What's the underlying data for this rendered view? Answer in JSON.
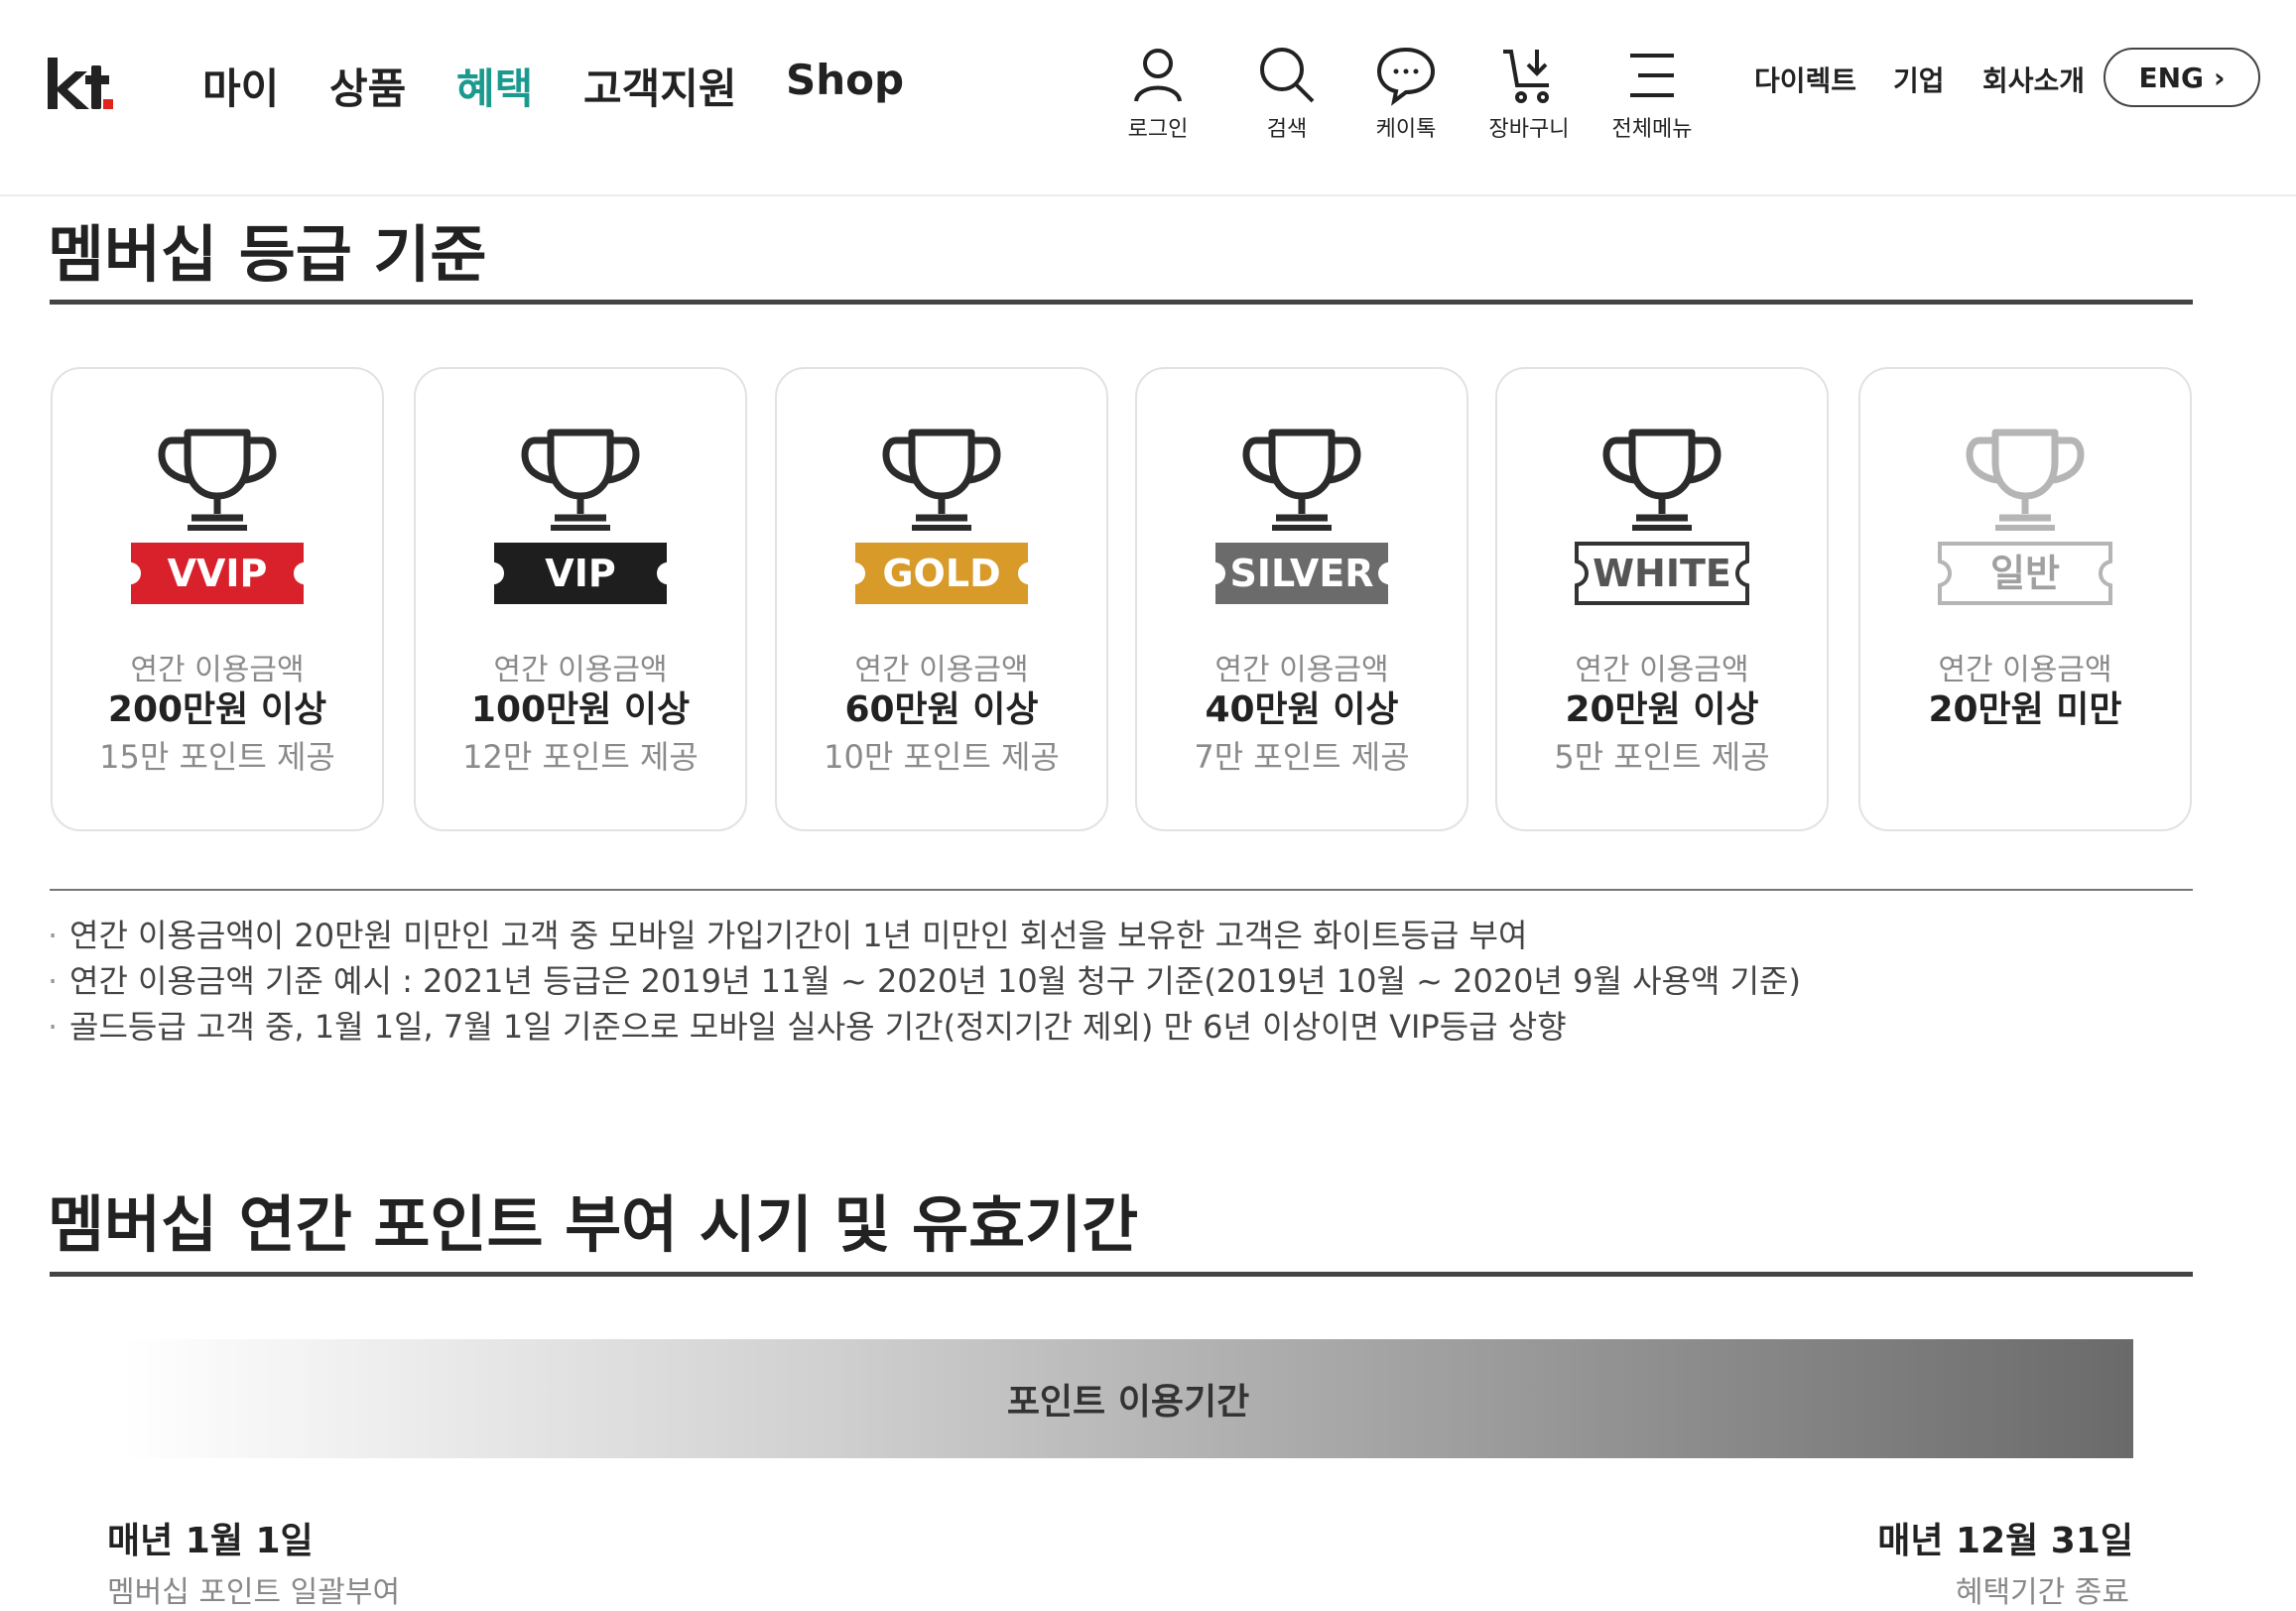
{
  "header": {
    "logo": "kt",
    "nav": [
      "마이",
      "상품",
      "혜택",
      "고객지원",
      "Shop"
    ],
    "active_nav": "혜택",
    "utility": [
      {
        "label": "로그인",
        "icon": "user-icon"
      },
      {
        "label": "검색",
        "icon": "search-icon"
      },
      {
        "label": "케이톡",
        "icon": "chat-icon"
      },
      {
        "label": "장바구니",
        "icon": "cart-icon"
      },
      {
        "label": "전체메뉴",
        "icon": "menu-icon"
      }
    ],
    "links": [
      "다이렉트",
      "기업",
      "회사소개"
    ],
    "lang_button": "ENG",
    "accent_color": "#1a9a8f"
  },
  "grade_section": {
    "title": "멤버십 등급 기준",
    "cards": [
      {
        "grade": "VVIP",
        "label": "연간 이용금액",
        "amount": "200만원 이상",
        "points": "15만 포인트 제공",
        "color": "#d9212b"
      },
      {
        "grade": "VIP",
        "label": "연간 이용금액",
        "amount": "100만원 이상",
        "points": "12만 포인트 제공",
        "color": "#1e1e1e"
      },
      {
        "grade": "GOLD",
        "label": "연간 이용금액",
        "amount": "60만원 이상",
        "points": "10만 포인트 제공",
        "color": "#d89a28"
      },
      {
        "grade": "SILVER",
        "label": "연간 이용금액",
        "amount": "40만원 이상",
        "points": "7만 포인트 제공",
        "color": "#6b6b6b"
      },
      {
        "grade": "WHITE",
        "label": "연간 이용금액",
        "amount": "20만원 이상",
        "points": "5만 포인트 제공",
        "color": "#333333"
      },
      {
        "grade": "일반",
        "label": "연간 이용금액",
        "amount": "20만원 미만",
        "points": "",
        "color": "#b5b5b5"
      }
    ],
    "notes": [
      "연간 이용금액이 20만원 미만인 고객 중 모바일 가입기간이 1년 미만인 회선을 보유한 고객은 화이트등급 부여",
      "연간 이용금액 기준 예시 : 2021년 등급은 2019년 11월 ~ 2020년 10월 청구 기준(2019년 10월 ~ 2020년 9월 사용액 기준)",
      "골드등급 고객 중, 1월 1일, 7월 1일 기준으로 모바일 실사용 기간(정지기간 제외) 만 6년 이상이면 VIP등급 상향"
    ]
  },
  "period_section": {
    "title": "멤버십 연간 포인트 부여 시기 및 유효기간",
    "bar_label": "포인트 이용기간",
    "start": {
      "date": "매년 1월 1일",
      "desc": "멤버십 포인트 일괄부여"
    },
    "end": {
      "date": "매년 12월 31일",
      "desc": "혜택기간 종료"
    }
  }
}
